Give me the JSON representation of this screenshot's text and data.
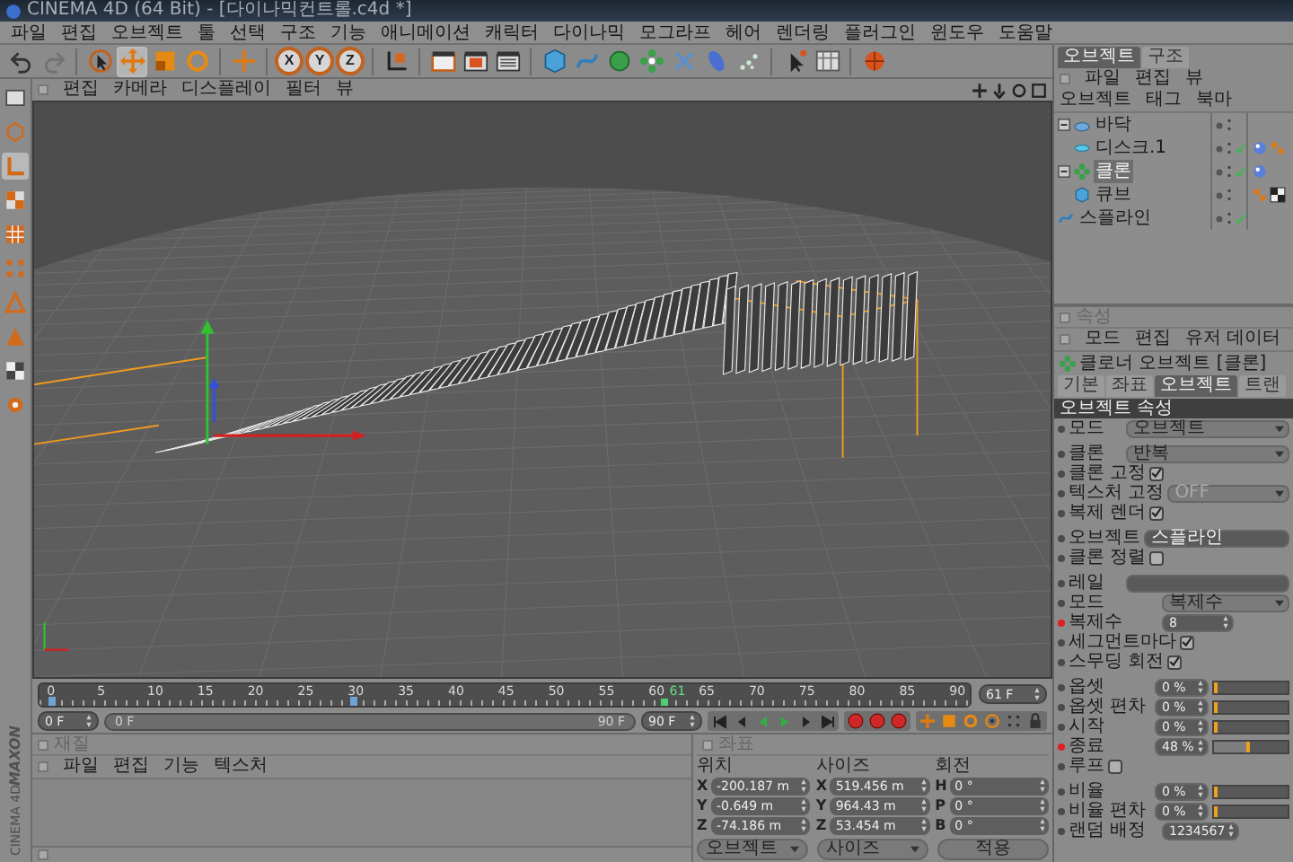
{
  "window": {
    "title": "CINEMA 4D (64 Bit) - [다이나믹컨트롤.c4d *]"
  },
  "menu": [
    "파일",
    "편집",
    "오브젝트",
    "툴",
    "선택",
    "구조",
    "기능",
    "애니메이션",
    "캐릭터",
    "다이나믹",
    "모그라프",
    "헤어",
    "렌더링",
    "플러그인",
    "윈도우",
    "도움말"
  ],
  "toolbar": [
    {
      "kind": "tool",
      "selected": false,
      "disabled": false
    },
    {
      "kind": "tool",
      "selected": false,
      "disabled": true
    },
    {
      "kind": "tool",
      "selected": false,
      "disabled": false
    },
    {
      "kind": "tool",
      "selected": true,
      "disabled": false
    },
    {
      "kind": "tool",
      "selected": false,
      "disabled": false
    },
    {
      "kind": "tool",
      "selected": false,
      "disabled": false
    },
    {
      "kind": "tool",
      "selected": false,
      "disabled": false
    },
    {
      "kind": "axis",
      "label": "X",
      "on": true
    },
    {
      "kind": "axis",
      "label": "Y",
      "on": true
    },
    {
      "kind": "axis",
      "label": "Z",
      "on": true
    },
    {
      "kind": "tool",
      "selected": false,
      "disabled": false
    },
    {
      "kind": "tool",
      "selected": false,
      "disabled": false
    },
    {
      "kind": "tool",
      "selected": false,
      "disabled": false
    },
    {
      "kind": "tool",
      "selected": false,
      "disabled": false
    },
    {
      "kind": "tool",
      "selected": false,
      "disabled": false
    },
    {
      "kind": "tool",
      "selected": false,
      "disabled": false
    },
    {
      "kind": "tool",
      "selected": false,
      "disabled": false
    },
    {
      "kind": "tool",
      "selected": false,
      "disabled": false
    },
    {
      "kind": "tool",
      "selected": false,
      "disabled": false
    },
    {
      "kind": "tool",
      "selected": false,
      "disabled": false
    },
    {
      "kind": "tool",
      "selected": false,
      "disabled": false
    },
    {
      "kind": "tool",
      "selected": false,
      "disabled": false
    },
    {
      "kind": "tool",
      "selected": false,
      "disabled": false
    },
    {
      "kind": "tool",
      "selected": false,
      "disabled": false
    }
  ],
  "left_toolbar": [
    {
      "selected": false
    },
    {
      "selected": false
    },
    {
      "selected": true
    },
    {
      "selected": false
    },
    {
      "selected": false
    },
    {
      "selected": false
    },
    {
      "selected": false
    },
    {
      "selected": false
    },
    {
      "selected": false
    },
    {
      "selected": false
    }
  ],
  "viewport": {
    "menu": [
      "편집",
      "카메라",
      "디스플레이",
      "필터",
      "뷰"
    ]
  },
  "timeline": {
    "ticks": [
      {
        "label": "0",
        "key": true
      },
      {
        "label": "5",
        "key": false
      },
      {
        "label": "10",
        "key": false
      },
      {
        "label": "15",
        "key": false
      },
      {
        "label": "20",
        "key": false
      },
      {
        "label": "25",
        "key": false
      },
      {
        "label": "30",
        "key": true
      },
      {
        "label": "35",
        "key": false
      },
      {
        "label": "40",
        "key": false
      },
      {
        "label": "45",
        "key": false
      },
      {
        "label": "50",
        "key": false
      },
      {
        "label": "55",
        "key": false
      },
      {
        "label": "60",
        "key": false
      },
      {
        "label": "65",
        "key": false
      },
      {
        "label": "70",
        "key": false
      },
      {
        "label": "75",
        "key": false
      },
      {
        "label": "80",
        "key": false
      },
      {
        "label": "85",
        "key": false
      },
      {
        "label": "90",
        "key": false
      }
    ],
    "current": "61",
    "current_field": "61 F"
  },
  "playback": {
    "start_field": "0 F",
    "range_start": "0 F",
    "range_end": "90 F",
    "level": 1,
    "end_field": "90 F"
  },
  "logo": {
    "brand": "MAXON",
    "product": "CINEMA 4D"
  },
  "materials": {
    "title": "재질",
    "menu": [
      "파일",
      "편집",
      "기능",
      "텍스처"
    ]
  },
  "coordinates": {
    "title": "좌표",
    "headers": [
      "위치",
      "사이즈",
      "회전"
    ],
    "rows": [
      {
        "cells": [
          {
            "axis": "X",
            "value": "-200.187 m"
          },
          {
            "axis": "X",
            "value": "519.456 m"
          },
          {
            "axis": "H",
            "value": "0 °"
          }
        ]
      },
      {
        "cells": [
          {
            "axis": "Y",
            "value": "-0.649 m"
          },
          {
            "axis": "Y",
            "value": "964.43 m"
          },
          {
            "axis": "P",
            "value": "0 °"
          }
        ]
      },
      {
        "cells": [
          {
            "axis": "Z",
            "value": "-74.186 m"
          },
          {
            "axis": "Z",
            "value": "53.454 m"
          },
          {
            "axis": "B",
            "value": "0 °"
          }
        ]
      }
    ],
    "dropdowns": [
      "오브젝트",
      "사이즈"
    ],
    "apply": "적용"
  },
  "objects_panel": {
    "tabs": [
      {
        "label": "오브젝트",
        "selected": true
      },
      {
        "label": "구조",
        "selected": false
      }
    ],
    "menu": [
      "파일",
      "편집",
      "뷰",
      "오브젝트",
      "태그",
      "북마"
    ],
    "objects": [
      {
        "name": "바닥",
        "kind": "floor",
        "selected": false,
        "enabled": false,
        "expanded": true,
        "children": [
          {
            "name": "디스크.1",
            "kind": "disc",
            "selected": false,
            "enabled": true,
            "tags": [
              {
                "kind": "material"
              },
              {
                "kind": "phong"
              }
            ]
          }
        ]
      },
      {
        "name": "클론",
        "kind": "cloner",
        "selected": true,
        "enabled": true,
        "expanded": true,
        "tags": [
          {
            "kind": "material"
          }
        ],
        "children": [
          {
            "name": "큐브",
            "kind": "cube",
            "selected": false,
            "enabled": false,
            "tags": [
              {
                "kind": "phong"
              },
              {
                "kind": "texture"
              }
            ]
          }
        ]
      },
      {
        "name": "스플라인",
        "kind": "spline",
        "selected": false,
        "enabled": true
      }
    ]
  },
  "attributes": {
    "title": "속성",
    "menu": [
      "모드",
      "편집",
      "유저 데이터"
    ],
    "object_title": "클로너 오브젝트 [클론]",
    "tabs": [
      {
        "label": "기본",
        "selected": false
      },
      {
        "label": "좌표",
        "selected": false
      },
      {
        "label": "오브젝트",
        "selected": true
      },
      {
        "label": "트랜",
        "selected": false
      }
    ],
    "section": "오브젝트 속성",
    "rows": [
      {
        "kind": "dropdown",
        "label": "모드",
        "value": "오브젝트",
        "keyed": false,
        "disabled": false
      },
      {
        "kind": "dropdown",
        "label": "클론",
        "value": "반복",
        "keyed": false,
        "disabled": false
      },
      {
        "kind": "check",
        "label": "클론 고정",
        "checked": true,
        "keyed": false
      },
      {
        "kind": "dropdown",
        "label": "텍스처 고정",
        "value": "OFF",
        "keyed": false,
        "disabled": true
      },
      {
        "kind": "check",
        "label": "복제 렌더",
        "checked": true,
        "keyed": false
      },
      {
        "kind": "link",
        "label": "오브젝트",
        "value": "스플라인",
        "keyed": false
      },
      {
        "kind": "check",
        "label": "클론 정렬",
        "checked": false,
        "keyed": false
      },
      {
        "kind": "link",
        "label": "레일",
        "keyed": false
      },
      {
        "kind": "dropdown",
        "label": "모드",
        "value": "복제수",
        "keyed": false,
        "disabled": false
      },
      {
        "kind": "number",
        "label": "복제수",
        "value": "8",
        "keyed": true
      },
      {
        "kind": "check",
        "label": "세그먼트마다",
        "checked": true,
        "keyed": false
      },
      {
        "kind": "check",
        "label": "스무딩 회전",
        "checked": true,
        "keyed": false
      },
      {
        "kind": "percent",
        "label": "옵셋",
        "value": "0 %",
        "level": 0,
        "keyed": false
      },
      {
        "kind": "percent",
        "label": "옵셋 편차",
        "value": "0 %",
        "level": 0,
        "keyed": false
      },
      {
        "kind": "percent",
        "label": "시작",
        "value": "0 %",
        "level": 0,
        "keyed": false
      },
      {
        "kind": "percent",
        "label": "종료",
        "value": "48 %",
        "level": 0.48,
        "keyed": true
      },
      {
        "kind": "check",
        "label": "루프",
        "checked": false,
        "keyed": false
      },
      {
        "kind": "percent",
        "label": "비율",
        "value": "0 %",
        "level": 0,
        "keyed": false
      },
      {
        "kind": "percent",
        "label": "비율 편차",
        "value": "0 %",
        "level": 0,
        "keyed": false
      },
      {
        "kind": "number",
        "label": "랜덤 배정",
        "value": "1234567",
        "keyed": false
      }
    ]
  }
}
